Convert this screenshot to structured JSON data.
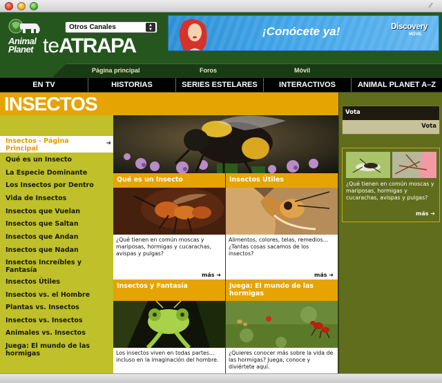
{
  "header": {
    "logo_line1": "Animal",
    "logo_line2": "Planet",
    "brand_te": "te",
    "brand_atrapa": "ATRAPA",
    "channel_select": "Otros Canales",
    "banner_text": "¡Conócete ya!",
    "banner_brand": "Discovery",
    "banner_brand_sub": "MÓVIL"
  },
  "subnav": [
    "Página principal",
    "Foros",
    "Móvil"
  ],
  "mainnav": [
    "EN TV",
    "HISTORIAS",
    "SERIES ESTELARES",
    "INTERACTIVOS",
    "ANIMAL PLANET A–Z"
  ],
  "page_title": "INSECTOS",
  "sidebar": {
    "active": "Insectos - Página Principal",
    "items": [
      "Qué es un Insecto",
      "La Especie Dominante",
      "Los Insectos por Dentro",
      "Vida de Insectos",
      "Insectos que Vuelan",
      "Insectos que Saltan",
      "Insectos que Andan",
      "Insectos que Nadan",
      "Insectos Increíbles y Fantasía",
      "Insectos Útiles",
      "Insectos vs. el Hombre",
      "Plantas vs. Insectos",
      "Insectos vs. Insectos",
      "Animales vs. Insectos",
      "Juega: El mundo de las hormigas"
    ]
  },
  "tiles": [
    {
      "title": "Qué es un Insecto",
      "text": "¿Qué tienen en común moscas y mariposas, hormigas y cucarachas, avispas y pulgas?",
      "more": "más"
    },
    {
      "title": "Insectos Útiles",
      "text": "Alimentos, colores, telas, remedios... ¿Tantas cosas sacamos de los insectos?",
      "more": "más"
    },
    {
      "title": "Insectos y Fantasía",
      "text": "Los insectos viven en todas partes... incluso en la imaginación del hombre."
    },
    {
      "title": "Juega: El mundo de las hormigas",
      "text": "¿Quieres conocer más sobre la vida de las hormigas? Juega, conoce y diviértete aquí."
    }
  ],
  "right": {
    "vota_title": "Vota",
    "vota_button": "Vota",
    "promo_text": "¿Qué tienen en común moscas y mariposas, hormigas y cucarachas, avispas y pulgas?",
    "promo_more": "más"
  }
}
